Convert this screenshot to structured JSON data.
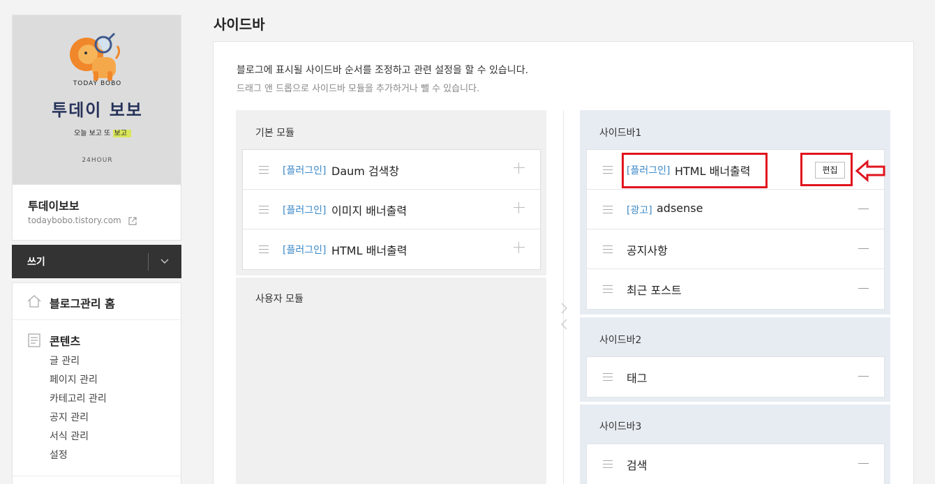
{
  "colors": {
    "accent": "#3b89c8",
    "highlight": "#e0141e",
    "dark_bar": "#333333",
    "sidebar_bg": "#e7ecf2"
  },
  "blog": {
    "logo_label": "TODAY BOBO",
    "logo_title": "투데이 보보",
    "logo_sub_plain": "오늘 보고 또 ",
    "logo_sub_highlight": "보고",
    "logo_hour": "24HOUR",
    "name": "투데이보보",
    "url": "todaybobo.tistory.com"
  },
  "write": {
    "label": "쓰기"
  },
  "menu": {
    "home": "블로그관리 홈",
    "content": "콘텐츠",
    "sub": [
      "글 관리",
      "페이지 관리",
      "카테고리 관리",
      "공지 관리",
      "서식 관리",
      "설정"
    ]
  },
  "page": {
    "title": "사이드바",
    "desc1": "블로그에 표시될 사이드바 순서를 조정하고 관련 설정을 할 수 있습니다.",
    "desc2": "드래그 앤 드롭으로 사이드바 모듈을 추가하거나 뺄 수 있습니다."
  },
  "basic": {
    "title": "기본 모듈",
    "modules": [
      {
        "tag": "[플러그인]",
        "name": "Daum 검색창"
      },
      {
        "tag": "[플러그인]",
        "name": "이미지 배너출력"
      },
      {
        "tag": "[플러그인]",
        "name": "HTML 배너출력"
      }
    ]
  },
  "user": {
    "title": "사용자 모듈"
  },
  "sidebar1": {
    "title": "사이드바1",
    "edit_label": "편집",
    "modules": [
      {
        "tag": "[플러그인]",
        "name": "HTML 배너출력"
      },
      {
        "tag": "[광고]",
        "name": "adsense"
      },
      {
        "tag": "",
        "name": "공지사항"
      },
      {
        "tag": "",
        "name": "최근 포스트"
      }
    ]
  },
  "sidebar2": {
    "title": "사이드바2",
    "modules": [
      {
        "name": "태그"
      }
    ]
  },
  "sidebar3": {
    "title": "사이드바3",
    "modules": [
      {
        "name": "검색"
      }
    ]
  }
}
